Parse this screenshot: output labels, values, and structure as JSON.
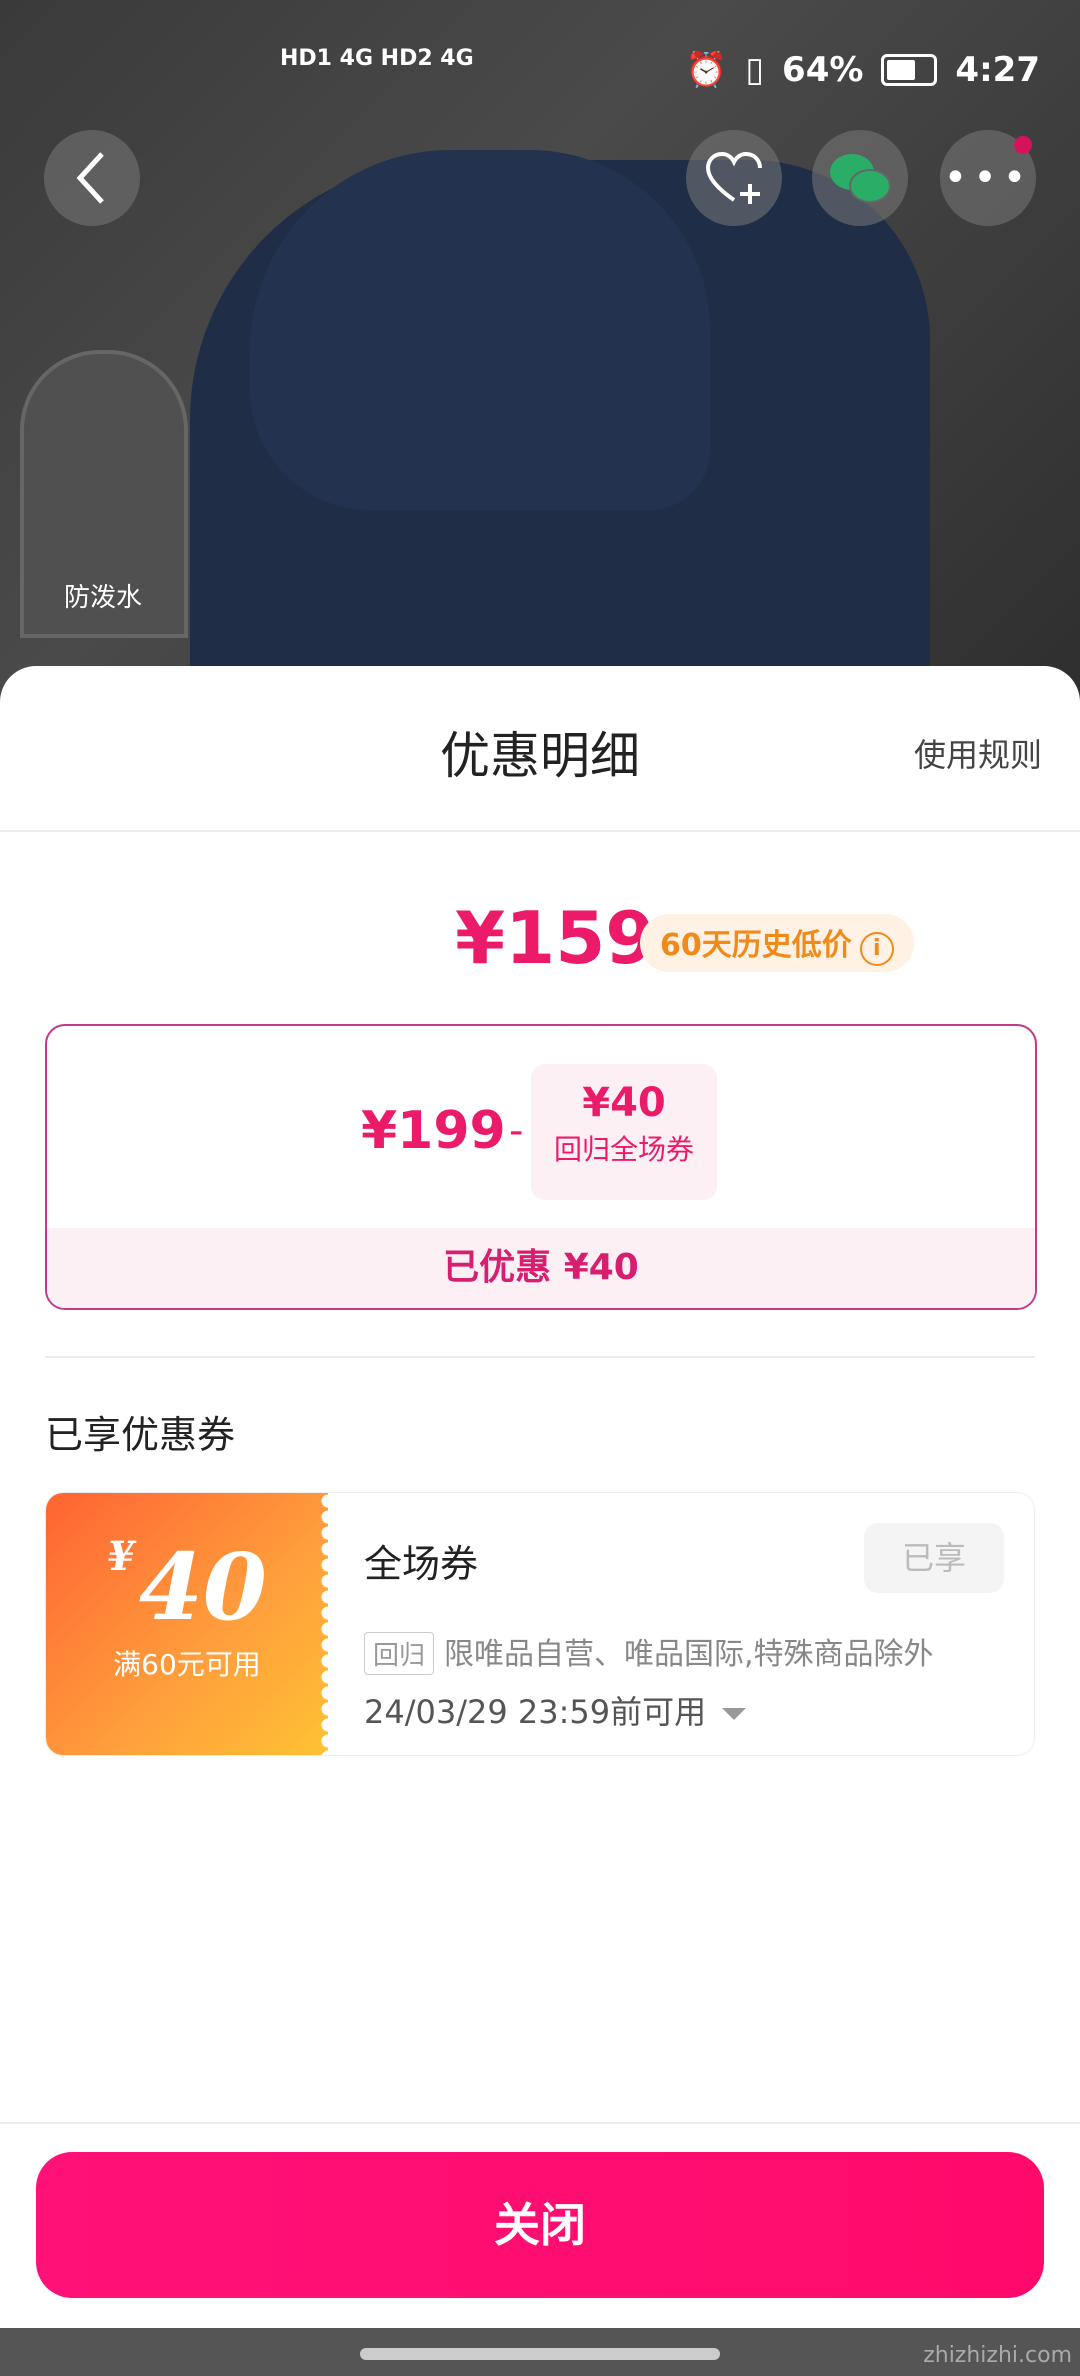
{
  "status_bar": {
    "signal": "HD1 4G HD2 4G",
    "battery": "64%",
    "time": "4:27"
  },
  "background": {
    "badge_text": "防泼水"
  },
  "sheet": {
    "title": "优惠明细",
    "rules_link": "使用规则",
    "final_price": "¥159",
    "history_tag": "60天历史低价",
    "original_price": "¥199",
    "minus": "-",
    "coupon_amount": "¥40",
    "coupon_label": "回归全场券",
    "saved_text": "已优惠 ¥40",
    "section_title": "已享优惠券",
    "coupon": {
      "currency": "¥",
      "amount": "40",
      "condition": "满60元可用",
      "name": "全场券",
      "status_button": "已享",
      "tag": "回归",
      "desc": "限唯品自营、唯品国际,特殊商品除外",
      "expiry": "24/03/29 23:59前可用"
    },
    "close_button": "关闭"
  },
  "watermark": "zhizhizhi.com",
  "colors": {
    "accent": "#ec1b6a",
    "button": "#ff1178",
    "history": "#f08a1a"
  }
}
